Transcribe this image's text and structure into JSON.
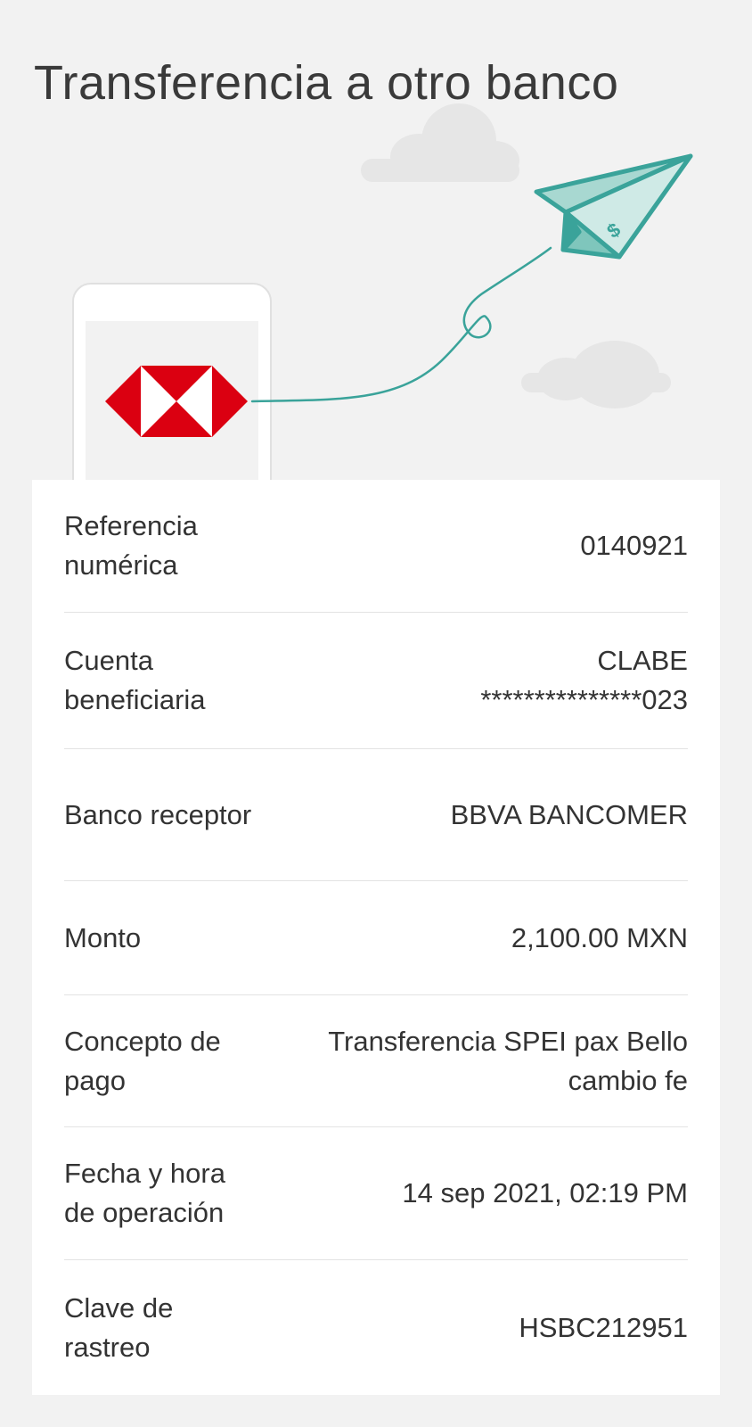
{
  "header": {
    "title": "Transferencia a otro banco"
  },
  "illustration": {
    "bank_logo": "hsbc-hexagon-logo",
    "plane_icon": "paper-plane-dollar-icon",
    "cloud_icon": "cloud-icon",
    "colors": {
      "logo_red": "#db0011",
      "plane_teal": "#3aa39a",
      "plane_fill": "#a8d8d1",
      "cloud_gray": "#e6e6e6"
    }
  },
  "details": {
    "rows": [
      {
        "label": "Referencia numérica",
        "value": "0140921"
      },
      {
        "label": "Cuenta beneficiaria",
        "value_line1": "CLABE",
        "value_line2": "***************023"
      },
      {
        "label": "Banco receptor",
        "value": "BBVA BANCOMER"
      },
      {
        "label": "Monto",
        "value": "2,100.00 MXN"
      },
      {
        "label": "Concepto de pago",
        "value": "Transferencia SPEI pax Bello cambio fe"
      },
      {
        "label": "Fecha y hora de operación",
        "value": "14 sep 2021, 02:19 PM"
      },
      {
        "label": "Clave de rastreo",
        "value": "HSBC212951"
      }
    ]
  }
}
